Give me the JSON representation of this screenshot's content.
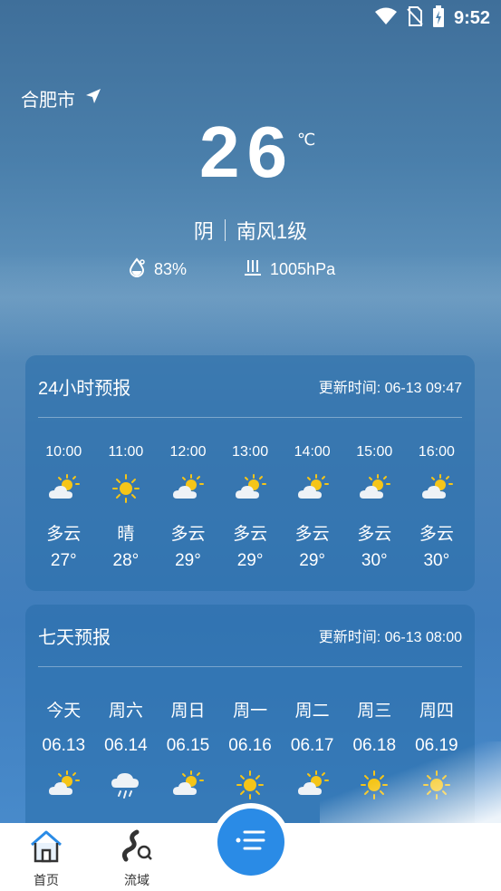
{
  "status_bar": {
    "time": "9:52"
  },
  "location": {
    "city": "合肥市"
  },
  "current": {
    "temperature": "26",
    "unit": "℃",
    "condition": "阴",
    "wind": "南风1级",
    "humidity": "83%",
    "pressure": "1005hPa"
  },
  "hourly": {
    "title": "24小时预报",
    "updated": "更新时间: 06-13 09:47",
    "items": [
      {
        "time": "10:00",
        "cond": "多云",
        "temp": "27°",
        "icon": "partly-cloudy-icon"
      },
      {
        "time": "11:00",
        "cond": "晴",
        "temp": "28°",
        "icon": "sunny-icon"
      },
      {
        "time": "12:00",
        "cond": "多云",
        "temp": "29°",
        "icon": "partly-cloudy-icon"
      },
      {
        "time": "13:00",
        "cond": "多云",
        "temp": "29°",
        "icon": "partly-cloudy-icon"
      },
      {
        "time": "14:00",
        "cond": "多云",
        "temp": "29°",
        "icon": "partly-cloudy-icon"
      },
      {
        "time": "15:00",
        "cond": "多云",
        "temp": "30°",
        "icon": "partly-cloudy-icon"
      },
      {
        "time": "16:00",
        "cond": "多云",
        "temp": "30°",
        "icon": "partly-cloudy-icon"
      }
    ]
  },
  "daily": {
    "title": "七天预报",
    "updated": "更新时间: 06-13 08:00",
    "items": [
      {
        "day": "今天",
        "date": "06.13",
        "icon": "partly-cloudy-icon"
      },
      {
        "day": "周六",
        "date": "06.14",
        "icon": "rain-icon"
      },
      {
        "day": "周日",
        "date": "06.15",
        "icon": "partly-cloudy-icon"
      },
      {
        "day": "周一",
        "date": "06.16",
        "icon": "sunny-icon"
      },
      {
        "day": "周二",
        "date": "06.17",
        "icon": "partly-cloudy-icon"
      },
      {
        "day": "周三",
        "date": "06.18",
        "icon": "sunny-icon"
      },
      {
        "day": "周四",
        "date": "06.19",
        "icon": "sunny-icon"
      }
    ]
  },
  "nav": {
    "home": "首页",
    "basin": "流域"
  },
  "colors": {
    "accent": "#2a8be6",
    "card": "#286eaa",
    "sun": "#f5c518"
  }
}
